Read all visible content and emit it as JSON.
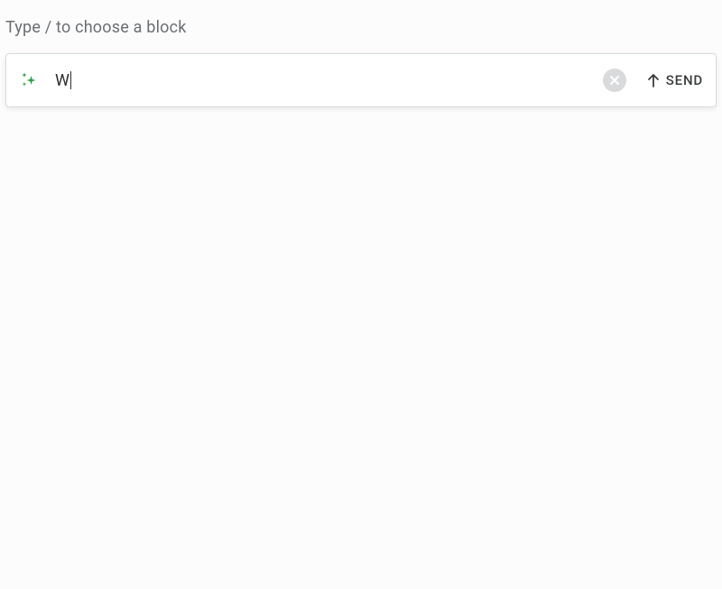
{
  "placeholder": "Type / to choose a block",
  "input": {
    "value": "W",
    "send_label": "SEND"
  },
  "icons": {
    "sparkle_color": "#2a9d4a",
    "clear_bg": "#d8dadc",
    "clear_x": "#ffffff",
    "arrow_color": "#3a3c3e"
  }
}
